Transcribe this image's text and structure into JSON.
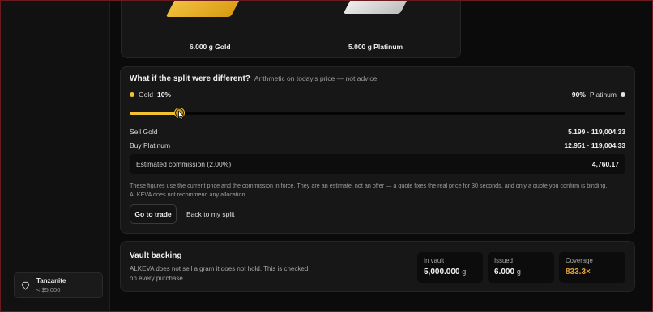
{
  "sidebar": {
    "gem": {
      "name": "Tanzanite",
      "price": "< $5,000",
      "icon": "gem-icon"
    }
  },
  "top_card": {
    "gold_label": "6.000 g Gold",
    "platinum_label": "5.000 g Platinum"
  },
  "split": {
    "title": "What if the split were different?",
    "subtitle": "Arithmetic on today's price — not advice",
    "gold_name": "Gold",
    "gold_pct": "10%",
    "platinum_pct": "90%",
    "platinum_name": "Platinum",
    "slider_fraction": 0.1,
    "sell_label": "Sell Gold",
    "sell_value": "5.199 · 119,004.33",
    "buy_label": "Buy Platinum",
    "buy_value": "12.951 · 119,004.33",
    "commission_label": "Estimated commission (2.00%)",
    "commission_value": "4,760.17",
    "disclaimer": "These figures use the current price and the commission in force. They are an estimate, not an offer — a quote fixes the real price for 30 seconds, and only a quote you confirm is binding. ALKEVA does not recommend any allocation.",
    "trade_button": "Go to trade",
    "back_link": "Back to my split"
  },
  "vault": {
    "title": "Vault backing",
    "description": "ALKEVA does not sell a gram it does not hold. This is checked on every purchase.",
    "in_vault_label": "In vault",
    "in_vault_value": "5,000.000",
    "in_vault_unit": "g",
    "issued_label": "Issued",
    "issued_value": "6.000",
    "issued_unit": "g",
    "coverage_label": "Coverage",
    "coverage_value": "833.3×"
  },
  "colors": {
    "gold_accent": "#f2c230",
    "coverage_accent": "#e8a23a",
    "frame_border": "#6b1a1f"
  }
}
